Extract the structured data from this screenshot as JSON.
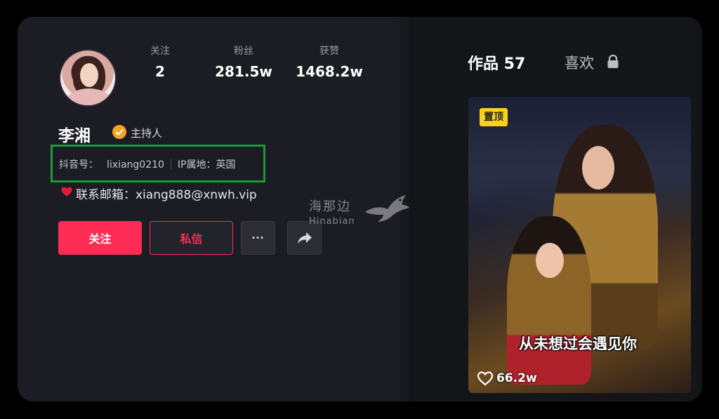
{
  "profile": {
    "name": "李湘",
    "role": "主持人",
    "douyin_id_label": "抖音号：",
    "douyin_id": "lixiang0210",
    "ip_label": "IP属地：",
    "ip_location": "英国",
    "email_label": "联系邮箱：",
    "email": "xiang888@xnwh.vip"
  },
  "stats": [
    {
      "label": "关注",
      "value": "2"
    },
    {
      "label": "粉丝",
      "value": "281.5w"
    },
    {
      "label": "获赞",
      "value": "1468.2w"
    }
  ],
  "actions": {
    "follow_label": "关注",
    "message_label": "私信",
    "more_label": "···"
  },
  "watermark": {
    "cn": "海那边",
    "en": "Hinabian"
  },
  "tabs": {
    "works_label": "作品 57",
    "likes_label": "喜欢"
  },
  "video": {
    "pin_label": "置顶",
    "caption": "从未想过会遇见你",
    "like_count": "66.2w"
  },
  "colors": {
    "accent": "#fe2c55",
    "verify": "#f2a624",
    "highlight_box": "#1a9b3a",
    "pin_tag": "#f9d21a"
  },
  "icons": [
    "verified-badge-icon",
    "heart-icon",
    "share-icon",
    "lock-icon",
    "like-heart-icon",
    "bird-logo-icon"
  ]
}
